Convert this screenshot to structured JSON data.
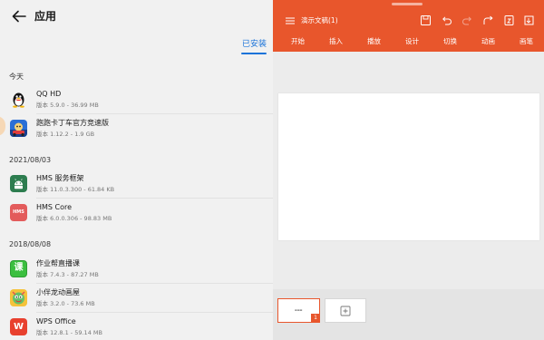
{
  "header": {
    "title": "应用",
    "tab_installed": "已安装"
  },
  "sections": [
    {
      "date": "今天",
      "apps": [
        {
          "name": "QQ HD",
          "version": "版本 5.9.0 - 36.99 MB",
          "icon": "qq-penguin-icon"
        },
        {
          "name": "跑跑卡丁车官方竞速版",
          "version": "版本 1.12.2 - 1.9 GB",
          "icon": "kart-rider-icon"
        }
      ]
    },
    {
      "date": "2021/08/03",
      "apps": [
        {
          "name": "HMS 服务框架",
          "version": "版本 11.0.3.300 - 61.84 KB",
          "icon": "android-icon"
        },
        {
          "name": "HMS Core",
          "version": "版本 6.0.0.306 - 98.83 MB",
          "icon": "hms-core-icon"
        }
      ]
    },
    {
      "date": "2018/08/08",
      "apps": [
        {
          "name": "作业帮直播课",
          "version": "版本 7.4.3 - 87.27 MB",
          "icon": "zuoyebang-icon"
        },
        {
          "name": "小伴龙动画屋",
          "version": "版本 3.2.0 - 73.6 MB",
          "icon": "xiaobanlong-icon"
        },
        {
          "name": "WPS Office",
          "version": "版本 12.8.1 - 59.14 MB",
          "icon": "wps-icon"
        }
      ]
    }
  ],
  "hms_icon_text": "HMS",
  "zuoyebang_icon_text": "课",
  "wps_icon_text": "W",
  "presentation": {
    "doc_title": "演示文稿(1)",
    "tabs": [
      "开始",
      "插入",
      "播放",
      "设计",
      "切换",
      "动画",
      "画笔"
    ],
    "thumb_number": "1",
    "accent_color": "#e8562c"
  }
}
